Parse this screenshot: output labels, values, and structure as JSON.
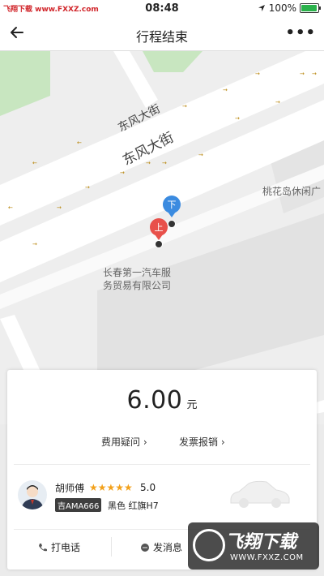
{
  "status_bar": {
    "watermark": "飞翔下载 www.FXXZ.com",
    "time": "08:48",
    "battery": "100%",
    "battery_level": 0.95
  },
  "nav": {
    "title": "行程结束",
    "back_icon": "back-arrow-icon",
    "more_icon": "more-icon",
    "more_label": "•••"
  },
  "map": {
    "street_label_small": "东风大街",
    "street_label_large": "东风大街",
    "poi_right": "桃花岛休闲广",
    "poi_company_line1": "长春第一汽车服",
    "poi_company_line2": "务贸易有限公司",
    "pin_dropoff": "下",
    "pin_pickup": "上",
    "dropoff_color": "#3b8be0",
    "pickup_color": "#e8504a"
  },
  "fare": {
    "amount": "6.00",
    "unit": "元",
    "link_question": "费用疑问",
    "link_invoice": "发票报销"
  },
  "driver": {
    "name": "胡师傅",
    "stars": "★★★★★",
    "rating": "5.0",
    "plate": "吉AMA666",
    "car": "黑色 红旗H7"
  },
  "actions": {
    "call": "打电话",
    "message": "发消息"
  },
  "watermark_badge": {
    "title": "飞翔下载",
    "url": "WWW.FXXZ.COM"
  }
}
